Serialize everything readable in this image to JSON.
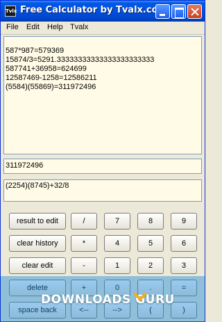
{
  "window": {
    "title": "Free Calculator by Tvalx.com",
    "icon_label": "Tvlx"
  },
  "menu": [
    "File",
    "Edit",
    "Help",
    "Tvalx"
  ],
  "history": [
    "587*987=579369",
    "15874/3=5291.33333333333333333333333",
    "587741+36958=624699",
    "12587469-1258=12586211",
    "(5584)(55869)=311972496"
  ],
  "result": "311972496",
  "input": "(2254)(8745)+32/8",
  "buttons": {
    "result_to_edit": "result to edit",
    "clear_history": "clear history",
    "clear_edit": "clear edit",
    "delete": "delete",
    "space_back": "space back",
    "rows": [
      [
        "/",
        "7",
        "8",
        "9"
      ],
      [
        "*",
        "4",
        "5",
        "6"
      ],
      [
        "-",
        "1",
        "2",
        "3"
      ],
      [
        "+",
        "0",
        ".",
        "="
      ],
      [
        "<--",
        "-->",
        "(",
        ")"
      ]
    ]
  },
  "watermark": "DOWNLOADS GURU",
  "colors": {
    "titlebar": "#0054e3",
    "history_bg": "#fffbe6",
    "watermark": "#1e8cdc"
  }
}
